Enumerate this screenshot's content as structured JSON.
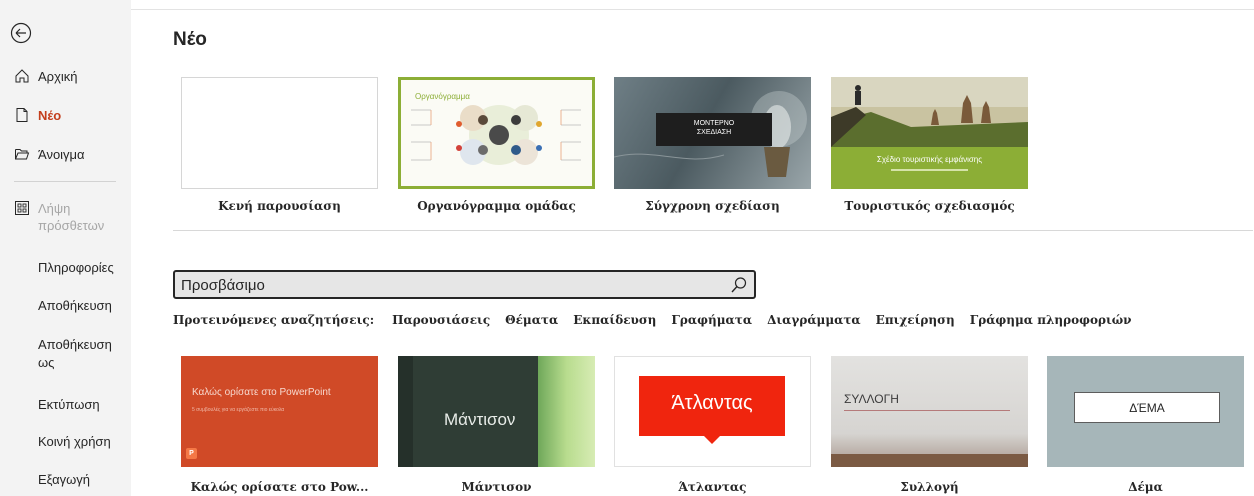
{
  "sidebar": {
    "back_label": "",
    "items": [
      {
        "label": "Αρχική",
        "icon": "home-icon"
      },
      {
        "label": "Νέο",
        "icon": "new-file-icon",
        "active": true
      },
      {
        "label": "Άνοιγμα",
        "icon": "folder-open-icon"
      }
    ],
    "addins": {
      "label": "Λήψη πρόσθετων",
      "icon": "addins-icon"
    },
    "text_items": [
      {
        "label": "Πληροφορίες"
      },
      {
        "label": "Αποθήκευση"
      },
      {
        "label": "Αποθήκευση ως"
      },
      {
        "label": "Εκτύπωση"
      },
      {
        "label": "Κοινή χρήση"
      },
      {
        "label": "Εξαγωγή"
      }
    ]
  },
  "main": {
    "title": "Νέο",
    "templates": [
      {
        "label": "Κενή παρουσίαση"
      },
      {
        "label": "Οργανόγραμμα ομάδας",
        "thumb_title": "Οργανόγραμμα"
      },
      {
        "label": "Σύγχρονη σχεδίαση",
        "thumb_title_line1": "ΜΟΝΤΕΡΝΟ",
        "thumb_title_line2": "ΣΧΕΔΙΑΣΗ"
      },
      {
        "label": "Τουριστικός σχεδιασμός",
        "thumb_title": "Σχέδιο τουριστικής εμφάνισης"
      }
    ],
    "search": {
      "value": "Προσβάσιμο",
      "placeholder": ""
    },
    "suggestions": {
      "label": "Προτεινόμενες αναζητήσεις:",
      "items": [
        "Παρουσιάσεις",
        "Θέματα",
        "Εκπαίδευση",
        "Γραφήματα",
        "Διαγράμματα",
        "Επιχείρηση",
        "Γράφημα πληροφοριών"
      ]
    },
    "themes": [
      {
        "label": "Καλώς ορίσατε στο Pow...",
        "thumb_title": "Καλώς ορίσατε στο PowerPoint",
        "thumb_sub": "5 συμβουλές για να εργάζεστε πιο εύκολα"
      },
      {
        "label": "Μάντισον",
        "thumb_title": "Μάντισον"
      },
      {
        "label": "Άτλαντας",
        "thumb_title": "Άτλαντας"
      },
      {
        "label": "Συλλογή",
        "thumb_title": "ΣΥΛΛΟΓΗ"
      },
      {
        "label": "Δέμα",
        "thumb_title": "ΔΈΜΑ"
      }
    ]
  },
  "colors": {
    "accent": "#c43e1c",
    "sidebar_bg": "#f3f3f3"
  }
}
